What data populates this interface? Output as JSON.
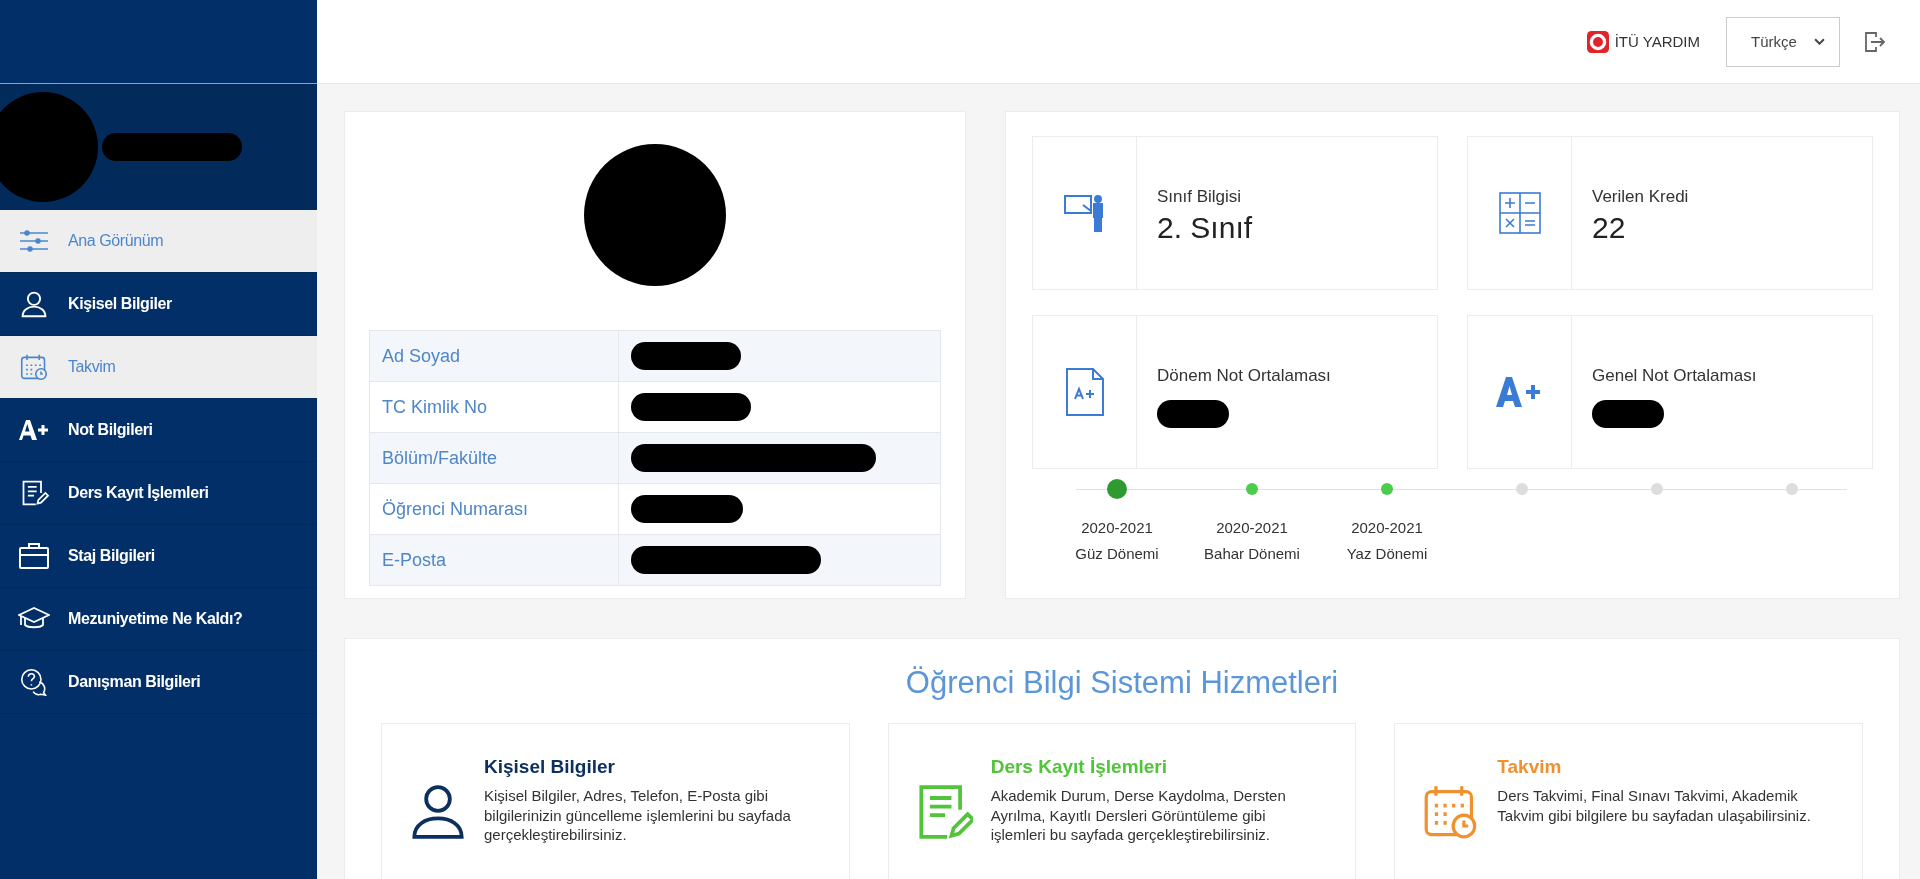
{
  "header": {
    "help_label": "İTÜ YARDIM",
    "language": "Türkçe"
  },
  "sidebar": {
    "items": [
      {
        "label": "Ana Görünüm",
        "kind": "sliders",
        "selected": true
      },
      {
        "label": "Kişisel Bilgiler",
        "kind": "person",
        "selected": false
      },
      {
        "label": "Takvim",
        "kind": "calendar",
        "selected": true
      },
      {
        "label": "Not Bilgileri",
        "kind": "grade",
        "selected": false
      },
      {
        "label": "Ders Kayıt İşlemleri",
        "kind": "document",
        "selected": false
      },
      {
        "label": "Staj Bilgileri",
        "kind": "briefcase",
        "selected": false
      },
      {
        "label": "Mezuniyetime Ne Kaldı?",
        "kind": "cap",
        "selected": false
      },
      {
        "label": "Danışman Bilgileri",
        "kind": "question",
        "selected": false
      }
    ]
  },
  "profile": {
    "fields": [
      {
        "label": "Ad Soyad"
      },
      {
        "label": "TC Kimlik No"
      },
      {
        "label": "Bölüm/Fakülte"
      },
      {
        "label": "Öğrenci Numarası"
      },
      {
        "label": "E-Posta"
      }
    ]
  },
  "stats": [
    {
      "kind": "teacher",
      "label": "Sınıf Bilgisi",
      "value": "2. Sınıf"
    },
    {
      "kind": "calculator",
      "label": "Verilen Kredi",
      "value": "22"
    },
    {
      "kind": "gradefile",
      "label": "Dönem Not Ortalaması"
    },
    {
      "kind": "grade",
      "label": "Genel Not Ortalaması"
    }
  ],
  "timeline": [
    {
      "kind": "current",
      "year": "2020-2021",
      "term": "Güz Dönemi"
    },
    {
      "kind": "done",
      "year": "2020-2021",
      "term": "Bahar Dönemi"
    },
    {
      "kind": "done",
      "year": "2020-2021",
      "term": "Yaz Dönemi"
    },
    {
      "kind": "pending"
    },
    {
      "kind": "pending"
    },
    {
      "kind": "pending"
    }
  ],
  "services": {
    "title": "Öğrenci Bilgi Sistemi Hizmetleri",
    "cards": [
      {
        "kind": "person",
        "color": "#0b2f5f",
        "title": "Kişisel Bilgiler",
        "text": "Kişisel Bilgiler, Adres, Telefon, E-Posta gibi bilgilerinizin güncelleme işlemlerini bu sayfada gerçekleştirebilirsiniz."
      },
      {
        "kind": "document",
        "color": "#52c43a",
        "title": "Ders Kayıt İşlemleri",
        "text": "Akademik Durum, Derse Kaydolma, Dersten Ayrılma, Kayıtlı Dersleri Görüntüleme gibi işlemleri bu sayfada gerçekleştirebilirsiniz."
      },
      {
        "kind": "calendar",
        "color": "#f0912f",
        "title": "Takvim",
        "text": "Ders Takvimi, Final Sınavı Takvimi, Akademik Takvim gibi bilgilere bu sayfadan ulaşabilirsiniz."
      }
    ]
  }
}
